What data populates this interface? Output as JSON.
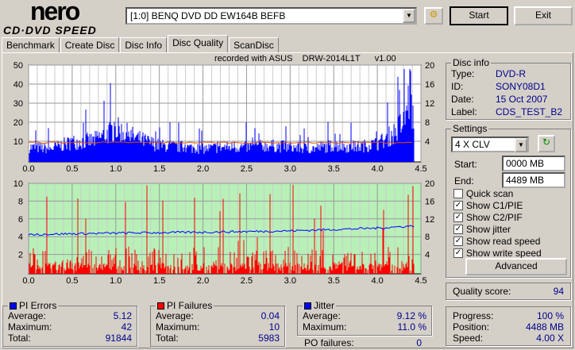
{
  "logo": {
    "brand": "nero",
    "product": "CD·DVD SPEED"
  },
  "toolbar": {
    "drive": "[1:0]  BENQ DVD DD EW164B BEFB",
    "start": "Start",
    "exit": "Exit"
  },
  "tabs": [
    "Benchmark",
    "Create Disc",
    "Disc Info",
    "Disc Quality",
    "ScanDisc"
  ],
  "recorded": "recorded with ASUS    DRW-2014L1T      v1.00",
  "disc_info": {
    "title": "Disc info",
    "type_label": "Type:",
    "type": "DVD-R",
    "id_label": "ID:",
    "id": "SONY08D1",
    "date_label": "Date:",
    "date": "15 Oct 2007",
    "label_label": "Label:",
    "label": "CDS_TEST_B2"
  },
  "settings": {
    "title": "Settings",
    "speed": "4 X CLV",
    "start_label": "Start:",
    "start": "0000 MB",
    "end_label": "End:",
    "end": "4489 MB",
    "checks": [
      {
        "label": "Quick scan",
        "checked": false
      },
      {
        "label": "Show C1/PIE",
        "checked": true
      },
      {
        "label": "Show C2/PIF",
        "checked": true
      },
      {
        "label": "Show jitter",
        "checked": true
      },
      {
        "label": "Show read speed",
        "checked": true
      },
      {
        "label": "Show write speed",
        "checked": true
      }
    ],
    "advanced": "Advanced"
  },
  "quality": {
    "label": "Quality score:",
    "value": "94"
  },
  "progress": {
    "progress_label": "Progress:",
    "progress": "100 %",
    "position_label": "Position:",
    "position": "4488 MB",
    "speed_label": "Speed:",
    "speed": "4.00 X"
  },
  "pi_errors": {
    "title": "PI Errors",
    "avg_label": "Average:",
    "avg": "5.12",
    "max_label": "Maximum:",
    "max": "42",
    "total_label": "Total:",
    "total": "91844",
    "color": "#0000ff"
  },
  "pi_failures": {
    "title": "PI Failures",
    "avg_label": "Average:",
    "avg": "0.04",
    "max_label": "Maximum:",
    "max": "10",
    "total_label": "Total:",
    "total": "5983",
    "color": "#ff0000"
  },
  "jitter": {
    "title": "Jitter",
    "avg_label": "Average:",
    "avg": "9.12 %",
    "max_label": "Maximum:",
    "max": "11.0 %",
    "color": "#0000ff"
  },
  "po": {
    "label": "PO failures:",
    "value": "0"
  },
  "chart_data": [
    {
      "type": "bar",
      "title": "PI Errors",
      "x_ticks": [
        "0.0",
        "0.5",
        "1.0",
        "1.5",
        "2.0",
        "2.5",
        "3.0",
        "3.5",
        "4.0",
        "4.5"
      ],
      "y_ticks": [
        "50",
        "40",
        "30",
        "20",
        "10"
      ],
      "y2_ticks": [
        "20",
        "16",
        "12",
        "8",
        "4"
      ],
      "xlim": [
        0,
        4.5
      ],
      "ylim": [
        0,
        50
      ],
      "y2lim": [
        0,
        20
      ],
      "pie_x": [
        0,
        0.25,
        0.5,
        0.75,
        1.0,
        1.25,
        1.5,
        1.75,
        2.0,
        2.25,
        2.5,
        2.75,
        3.0,
        3.25,
        3.5,
        3.75,
        4.0,
        4.1,
        4.2,
        4.3,
        4.38,
        4.42
      ],
      "pie_y": [
        9,
        8,
        12,
        13,
        20,
        14,
        10,
        9,
        8,
        9,
        9,
        10,
        9,
        8,
        10,
        9,
        11,
        14,
        18,
        24,
        42,
        20
      ],
      "read_speed_x": 4.0
    },
    {
      "type": "bar",
      "title": "PI Failures / Jitter",
      "x_ticks": [
        "0.0",
        "0.5",
        "1.0",
        "1.5",
        "2.0",
        "2.5",
        "3.0",
        "3.5",
        "4.0",
        "4.5"
      ],
      "y_ticks": [
        "10",
        "8",
        "6",
        "4",
        "2"
      ],
      "y2_ticks": [
        "20",
        "16",
        "12",
        "8",
        "4"
      ],
      "xlim": [
        0,
        4.5
      ],
      "ylim": [
        0,
        10
      ],
      "y2lim": [
        0,
        20
      ],
      "pif_max": 10,
      "jitter_x": [
        0,
        1,
        2,
        3,
        4,
        4.42
      ],
      "jitter_y": [
        8.7,
        9.0,
        9.2,
        9.5,
        10.1,
        10.6
      ]
    }
  ]
}
